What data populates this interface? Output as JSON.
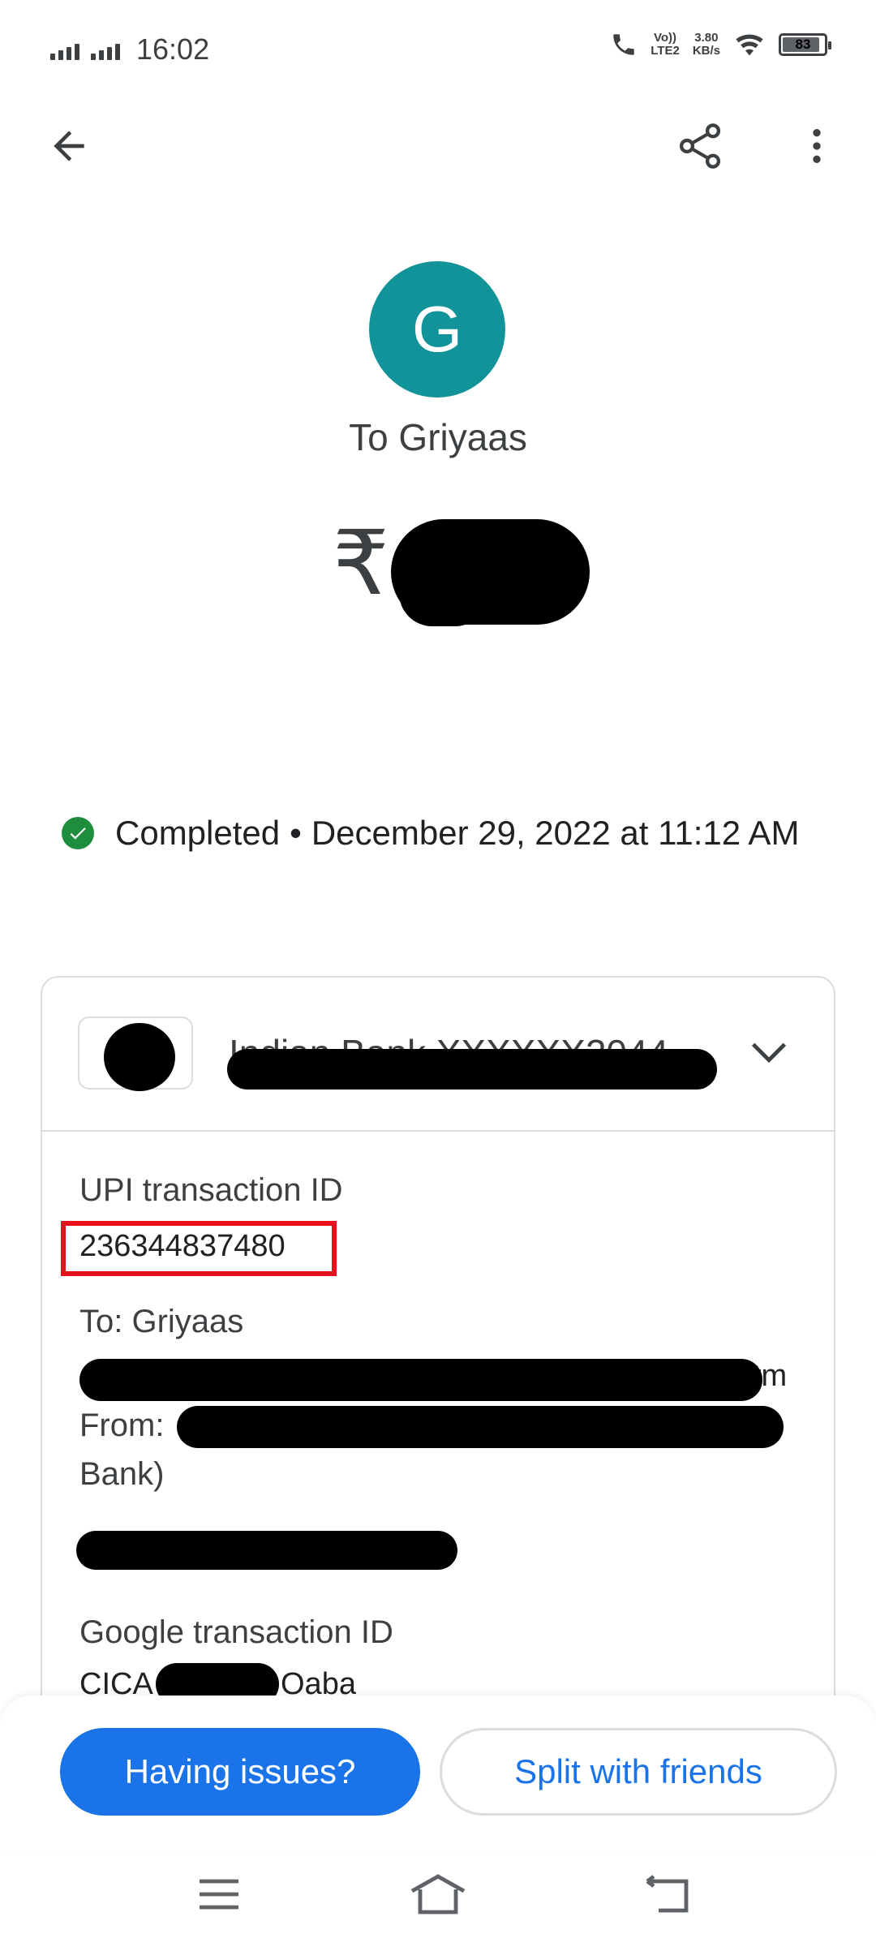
{
  "status_bar": {
    "time": "16:02",
    "volte_label_top": "Vo))",
    "volte_label_bottom": "LTE2",
    "speed_value": "3.80",
    "speed_unit": "KB/s",
    "battery_level": "83"
  },
  "app_bar": {
    "back_icon": "arrow-back-icon",
    "share_icon": "share-icon",
    "more_icon": "more-vert-icon"
  },
  "header": {
    "avatar_letter": "G",
    "avatar_color": "#12939a",
    "recipient": "To Griyaas",
    "currency_symbol": "₹"
  },
  "status": {
    "state": "Completed",
    "separator": "•",
    "datetime": "December 29, 2022 at 11:12 AM",
    "color": "#1e8e3e"
  },
  "account": {
    "label": "Indian Bank XXXXXX2044"
  },
  "details": {
    "upi_label": "UPI transaction ID",
    "upi_value": "236344837480",
    "to_label": "To: Griyaas",
    "to_suffix": "tm",
    "from_label": "From:",
    "from_bank": "Bank)",
    "google_label": "Google transaction ID",
    "google_prefix": "CICA",
    "google_suffix": "Oaba"
  },
  "actions": {
    "primary_label": "Having issues?",
    "secondary_label": "Split with friends",
    "accent": "#1a73e8"
  },
  "nav": {
    "menu_icon": "menu-icon",
    "home_icon": "home-icon",
    "back_icon": "nav-back-icon"
  }
}
